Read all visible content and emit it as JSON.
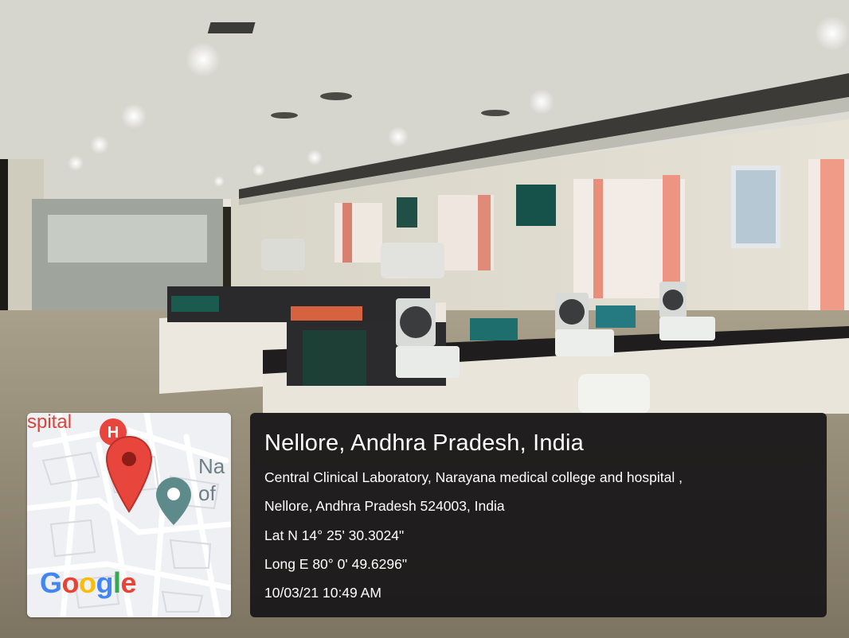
{
  "location": {
    "title": "Nellore, Andhra Pradesh, India",
    "address_line_1": "Central Clinical Laboratory, Narayana medical college and hospital ,",
    "address_line_2": "Nellore, Andhra Pradesh 524003, India",
    "latitude": "Lat N 14° 25' 30.3024\"",
    "longitude": "Long E 80° 0' 49.6296\"",
    "datetime": "10/03/21 10:49 AM"
  },
  "map": {
    "hospital_label": "spital",
    "place_label_line_1": "Na",
    "place_label_line_2": "of",
    "hospital_icon": "hospital-icon",
    "pin_icon": "red-location-pin-icon",
    "secondary_pin_icon": "teal-location-pin-icon",
    "logo": {
      "letters": [
        "G",
        "o",
        "o",
        "g",
        "l",
        "e"
      ],
      "colors": [
        "#4285F4",
        "#EA4335",
        "#FBBC05",
        "#4285F4",
        "#34A853",
        "#EA4335"
      ]
    }
  },
  "colors": {
    "panel_background": "#181618",
    "pin_red": "#E8453C",
    "pin_teal": "#5F8A8B"
  }
}
